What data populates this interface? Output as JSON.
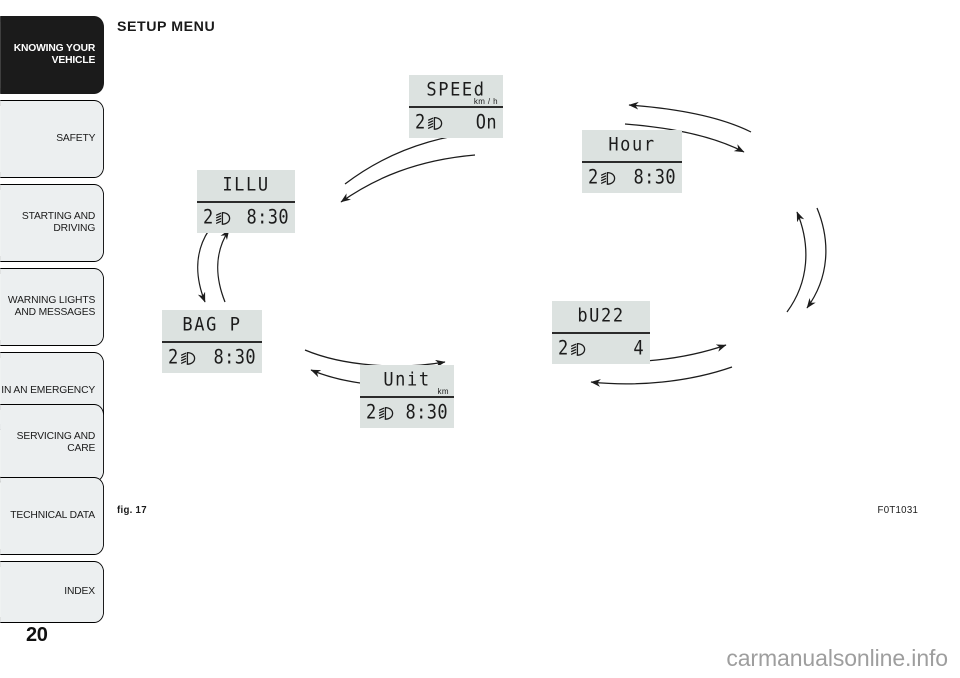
{
  "page": {
    "number": "20",
    "section_title": "SETUP MENU",
    "fig_caption": "fig. 17",
    "fig_code": "F0T1031",
    "watermark": "carmanualsonline.info",
    "lcd_bg_color": "#dce2e0",
    "active_tab_color": "#1b1b1b"
  },
  "sidebar": {
    "items": [
      {
        "label": "KNOWING YOUR VEHICLE",
        "active": true
      },
      {
        "label": "SAFETY",
        "active": false
      },
      {
        "label": "STARTING AND DRIVING",
        "active": false
      },
      {
        "label": "WARNING LIGHTS AND MESSAGES",
        "active": false
      },
      {
        "label": "IN AN EMERGENCY",
        "active": false
      },
      {
        "label": "SERVICING AND CARE",
        "active": false
      },
      {
        "label": "TECHNICAL DATA",
        "active": false
      },
      {
        "label": "INDEX",
        "active": false
      }
    ]
  },
  "diagram": {
    "type": "cycle",
    "icon": "low-beam-headlight-icon",
    "nodes": [
      {
        "id": "speed",
        "title": "SPEEd",
        "unit": "km / h",
        "digit": "2",
        "value": "On"
      },
      {
        "id": "hour",
        "title": "Hour",
        "unit": "",
        "digit": "2",
        "value": "8:30"
      },
      {
        "id": "buzz",
        "title": "bU22",
        "unit": "",
        "digit": "2",
        "value": "4"
      },
      {
        "id": "unit",
        "title": "Unit",
        "unit": "km",
        "digit": "2",
        "value": "8:30"
      },
      {
        "id": "bagp",
        "title": "BAG P",
        "unit": "",
        "digit": "2",
        "value": "8:30"
      },
      {
        "id": "illu",
        "title": "ILLU",
        "unit": "",
        "digit": "2",
        "value": "8:30"
      }
    ]
  }
}
